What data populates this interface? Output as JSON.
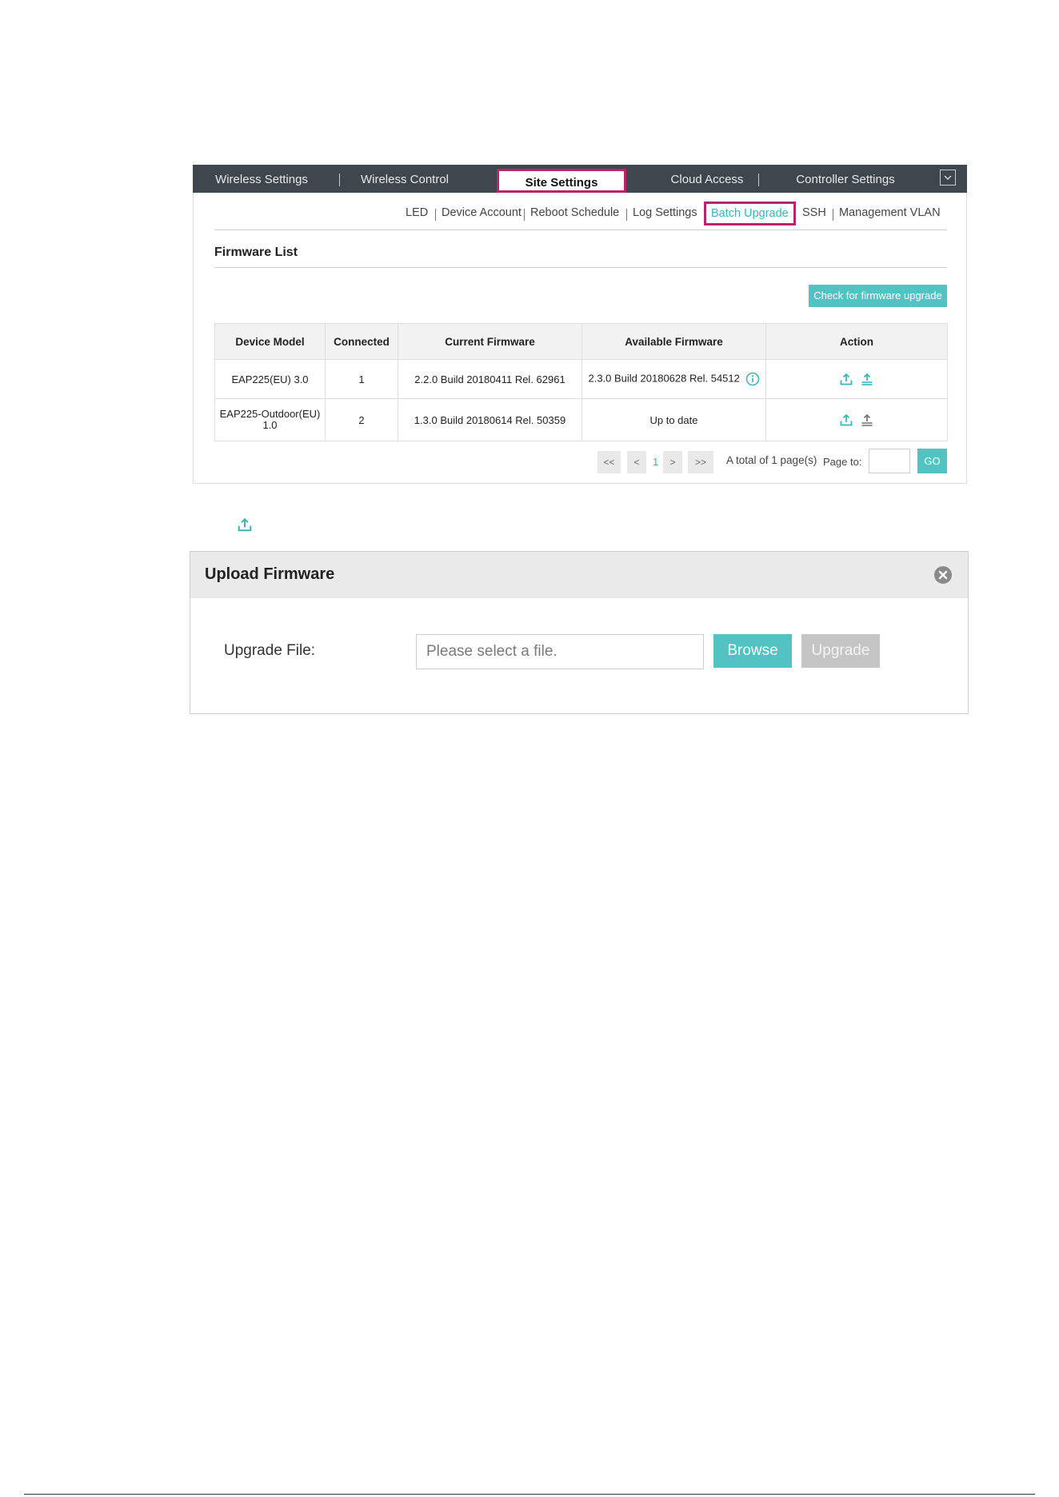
{
  "nav": {
    "items": [
      {
        "label": "Wireless Settings"
      },
      {
        "label": "Wireless Control"
      },
      {
        "label": "Site Settings"
      },
      {
        "label": "Cloud Access"
      },
      {
        "label": "Controller Settings"
      }
    ],
    "active_index": 2
  },
  "subnav": {
    "items": [
      {
        "label": "LED"
      },
      {
        "label": "Device Account"
      },
      {
        "label": "Reboot Schedule"
      },
      {
        "label": "Log Settings"
      },
      {
        "label": "Batch Upgrade"
      },
      {
        "label": "SSH"
      },
      {
        "label": "Management VLAN"
      }
    ],
    "active_index": 4
  },
  "firmware_list": {
    "title": "Firmware List",
    "check_button": "Check for firmware upgrade",
    "columns": [
      "Device Model",
      "Connected",
      "Current Firmware",
      "Available Firmware",
      "Action"
    ],
    "rows": [
      {
        "model": "EAP225(EU) 3.0",
        "connected": "1",
        "current": "2.2.0 Build 20180411 Rel. 62961",
        "available": "2.3.0 Build 20180628 Rel. 54512"
      },
      {
        "model": "EAP225-Outdoor(EU) 1.0",
        "connected": "2",
        "current": "1.3.0 Build 20180614 Rel. 50359",
        "available": "Up to date"
      }
    ]
  },
  "pagination": {
    "first": "<<",
    "prev": "<",
    "current": "1",
    "next": ">",
    "last": ">>",
    "total": "A total of 1 page(s)",
    "page_to": "Page to:",
    "go": "GO"
  },
  "dialog": {
    "title": "Upload Firmware",
    "field_label": "Upgrade File:",
    "file_placeholder": "Please select a file.",
    "browse": "Browse",
    "upgrade": "Upgrade"
  },
  "colors": {
    "accent": "#52c2c2",
    "nav_bg": "#3f464e",
    "highlight": "#b8256b"
  },
  "icons": [
    "chevron-down-icon",
    "upload-icon",
    "upgrade-icon",
    "info-icon",
    "close-icon"
  ]
}
